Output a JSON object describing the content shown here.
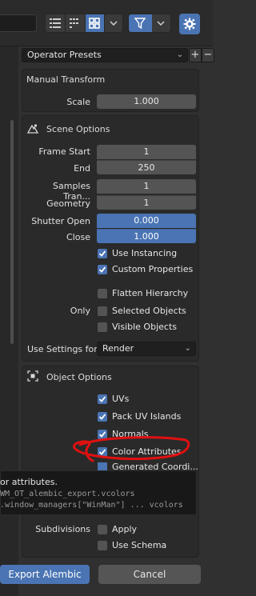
{
  "toolbar": {
    "icons": [
      "list-vertical-icon",
      "list-horizontal-icon",
      "thumbnails-icon",
      "chevron-down-icon",
      "filter-icon",
      "gear-icon"
    ],
    "active_view": "thumbnails-icon"
  },
  "presets": {
    "label": "Operator Presets",
    "add": "+",
    "remove": "−"
  },
  "manual_transform": {
    "title": "Manual Transform",
    "scale_label": "Scale",
    "scale_value": "1.000"
  },
  "scene_options": {
    "title": "Scene Options",
    "frame_start_label": "Frame Start",
    "frame_start_value": "1",
    "end_label": "End",
    "end_value": "250",
    "samples_label": "Samples Tran...",
    "samples_value": "1",
    "geometry_label": "Geometry",
    "geometry_value": "1",
    "shutter_open_label": "Shutter Open",
    "shutter_open_value": "0.000",
    "close_label": "Close",
    "close_value": "1.000",
    "use_instancing_label": "Use Instancing",
    "use_instancing": true,
    "custom_properties_label": "Custom Properties",
    "custom_properties": true,
    "flatten_hierarchy_label": "Flatten Hierarchy",
    "flatten_hierarchy": false,
    "only_label": "Only",
    "selected_objects_label": "Selected Objects",
    "selected_objects": false,
    "visible_objects_label": "Visible Objects",
    "visible_objects": false,
    "use_settings_label": "Use Settings for",
    "use_settings_value": "Render"
  },
  "object_options": {
    "title": "Object Options",
    "uvs_label": "UVs",
    "uvs": true,
    "pack_uv_label": "Pack UV Islands",
    "pack_uv": true,
    "normals_label": "Normals",
    "normals": true,
    "color_attributes_label": "Color Attributes",
    "color_attributes": true,
    "generated_coords_label": "Generated Coordi...",
    "generated_coords": true,
    "subdivisions_label": "Subdivisions",
    "apply_label": "Apply",
    "apply": false,
    "use_schema_label": "Use Schema",
    "use_schema": false
  },
  "tooltip": {
    "line1": "or attributes.",
    "line2": "WM_OT_alembic_export.vcolors",
    "line3": ".window_managers[\"WinMan\"] ... vcolors"
  },
  "buttons": {
    "export": "Export Alembic",
    "cancel": "Cancel"
  },
  "colors": {
    "accent": "#4a74b3",
    "background": "#303030",
    "annotation_red": "#e01010"
  }
}
